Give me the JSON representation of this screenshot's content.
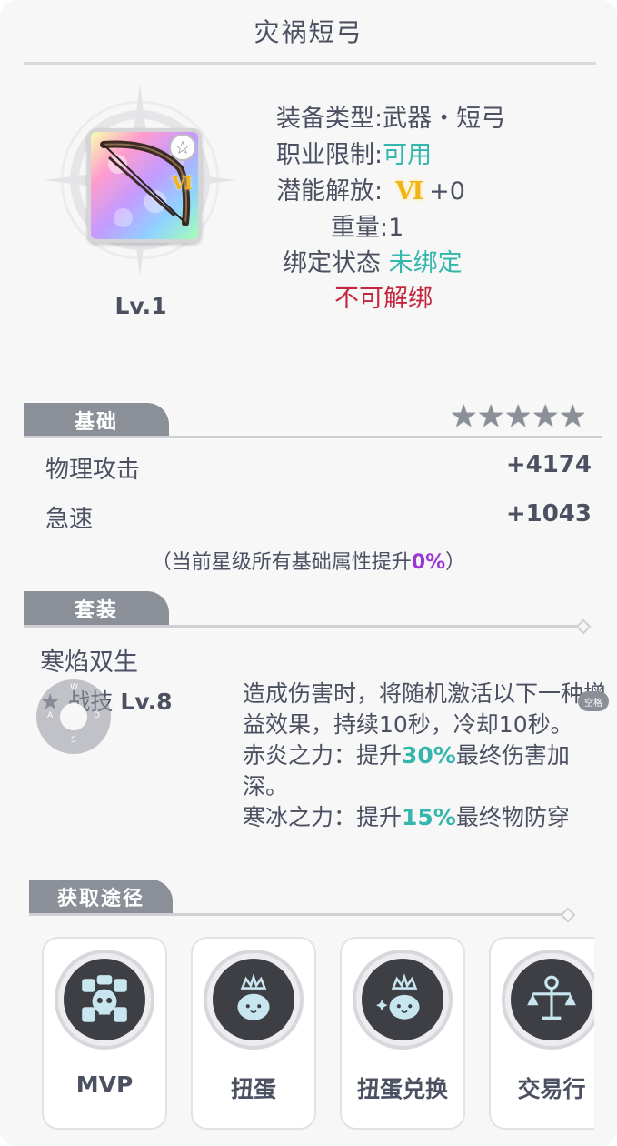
{
  "title": "灾祸短弓",
  "item": {
    "level": "Lv.1",
    "rank_badge": "Ⅵ",
    "star_badge_icon": "star-icon"
  },
  "info": {
    "type_label": "装备类型:",
    "type_value": "武器・短弓",
    "class_label": "职业限制:",
    "class_value": "可用",
    "potential_label": "潜能解放:",
    "potential_rank": "Ⅵ",
    "potential_value": "+0",
    "weight": "重量:1",
    "bind_label": "绑定状态",
    "bind_value": "未绑定",
    "unbind_note": "不可解绑"
  },
  "basic": {
    "tab_label": "基础",
    "star_count": 5,
    "stats": [
      {
        "name": "物理攻击",
        "value": "+4174"
      },
      {
        "name": "急速",
        "value": "+1043"
      }
    ],
    "note_prefix": "（当前星级所有基础属性提升",
    "note_value": "0%",
    "note_suffix": "）"
  },
  "set": {
    "tab_label": "套装",
    "name": "寒焰双生",
    "skill_label": "战技",
    "skill_level": "Lv.8",
    "desc": {
      "p1": "造成伤害时，将随机激活以下一种增益效果，持续10秒，冷却10秒。",
      "p2_prefix": "赤炎之力：提升",
      "p2_value": "30%",
      "p2_suffix": "最终伤害加深。",
      "p3_prefix": "寒冰之力：提升",
      "p3_value": "15%",
      "p3_suffix": "最终物防穿"
    }
  },
  "overlay": {
    "joystick_keys": [
      "W",
      "A",
      "D",
      "S"
    ],
    "space_key": "空格"
  },
  "routes": {
    "tab_label": "获取途径",
    "items": [
      {
        "label": "MVP",
        "icon": "mvp-skull-icon"
      },
      {
        "label": "扭蛋",
        "icon": "poring-crown-icon"
      },
      {
        "label": "扭蛋兑换",
        "icon": "poring-crown-sparkle-icon"
      },
      {
        "label": "交易行",
        "icon": "trade-scale-icon"
      }
    ]
  },
  "colors": {
    "teal": "#35b6ad",
    "red": "#c4273d",
    "purple": "#9b36d6",
    "tab_gray": "#8b8f98"
  }
}
